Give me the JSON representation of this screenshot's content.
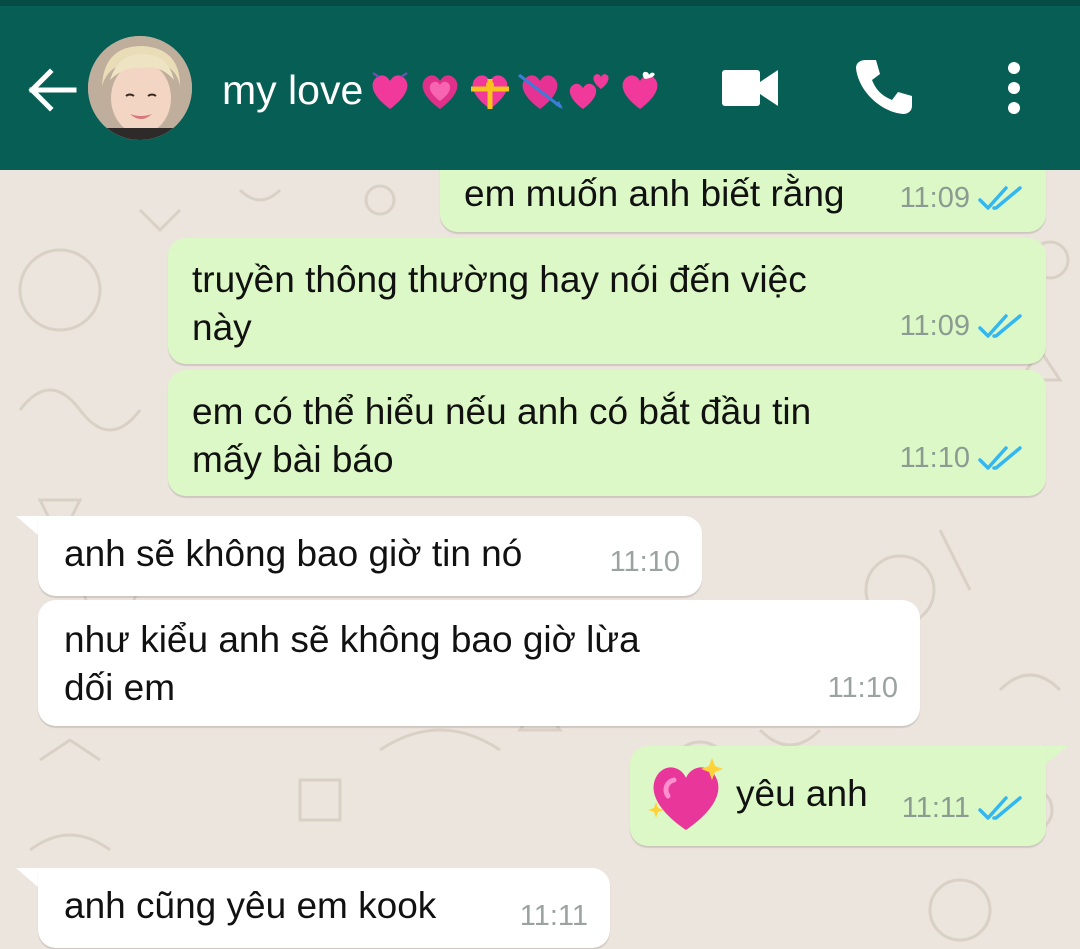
{
  "header": {
    "contact_name": "my love",
    "heart_emojis": [
      "heart-with-ribbon-icon",
      "growing-heart-icon",
      "heart-gift-icon",
      "heart-arrow-icon",
      "two-hearts-icon",
      "revolving-hearts-icon"
    ],
    "background_color": "#075E54"
  },
  "messages": [
    {
      "direction": "out",
      "text": "em muốn anh biết rằng",
      "time": "11:09",
      "status": "read"
    },
    {
      "direction": "out",
      "text": "truyền thông thường hay nói đến việc\nnày",
      "time": "11:09",
      "status": "read"
    },
    {
      "direction": "out",
      "text": "em có thể hiểu nếu anh có bắt đầu tin\nmấy bài báo",
      "time": "11:10",
      "status": "read"
    },
    {
      "direction": "in",
      "text": "anh sẽ không bao giờ tin nó",
      "time": "11:10"
    },
    {
      "direction": "in",
      "text": "như kiểu anh sẽ không bao giờ lừa\ndối em",
      "time": "11:10"
    },
    {
      "direction": "out",
      "emoji": "sparkling-heart-icon",
      "text": "yêu anh",
      "time": "11:11",
      "status": "read"
    },
    {
      "direction": "in",
      "text": "anh cũng yêu em kook",
      "time": "11:11"
    }
  ],
  "colors": {
    "outgoing_bubble": "#DCF8C6",
    "incoming_bubble": "#FFFFFF",
    "read_tick": "#34B7F1",
    "chat_background": "#ECE5DD"
  }
}
